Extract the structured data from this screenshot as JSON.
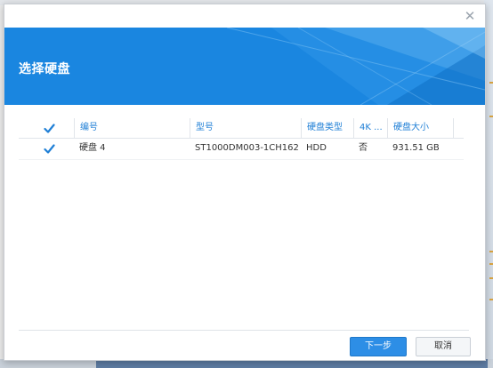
{
  "dialog": {
    "title": "选择硬盘",
    "close_glyph": "✕"
  },
  "grid": {
    "columns": [
      {
        "key": "number",
        "label": "编号"
      },
      {
        "key": "model",
        "label": "型号"
      },
      {
        "key": "disk_type",
        "label": "硬盘类型"
      },
      {
        "key": "four_k",
        "label": "4K ..."
      },
      {
        "key": "size",
        "label": "硬盘大小"
      }
    ],
    "header_checked": true,
    "rows": [
      {
        "checked": true,
        "number": "硬盘 4",
        "model": "ST1000DM003-1CH162",
        "disk_type": "HDD",
        "four_k": "否",
        "size": "931.51 GB"
      }
    ]
  },
  "footer": {
    "next_label": "下一步",
    "cancel_label": "取消"
  },
  "colors": {
    "banner": "#1a86e0",
    "accent": "#1f7fd6",
    "primary_button": "#2d8ee6"
  },
  "icons": {
    "close": "close-icon",
    "check": "checkmark-icon"
  }
}
